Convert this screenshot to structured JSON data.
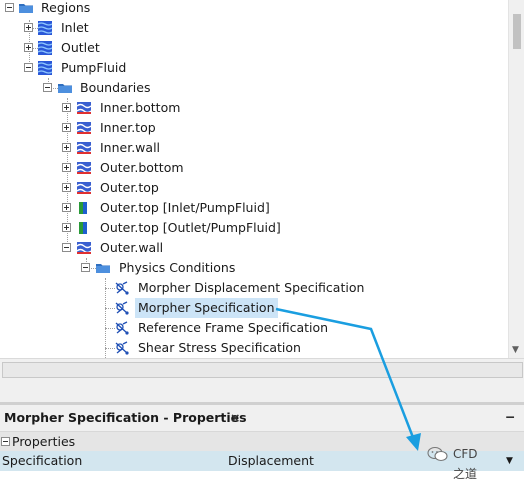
{
  "tree": {
    "regions": "Regions",
    "inlet": "Inlet",
    "outlet": "Outlet",
    "pumpfluid": "PumpFluid",
    "boundaries": "Boundaries",
    "items": [
      "Inner.bottom",
      "Inner.top",
      "Inner.wall",
      "Outer.bottom",
      "Outer.top",
      "Outer.top [Inlet/PumpFluid]",
      "Outer.top [Outlet/PumpFluid]",
      "Outer.wall"
    ],
    "physics_conditions": "Physics Conditions",
    "conditions": [
      "Morpher Displacement Specification",
      "Morpher Specification",
      "Reference Frame Specification",
      "Shear Stress Specification"
    ],
    "selected": "Morpher Specification"
  },
  "properties": {
    "title": "Morpher Specification - Properties",
    "close": "×",
    "minimize": "−",
    "group": "Properties",
    "prop_name": "Specification",
    "prop_value": "Displacement"
  },
  "watermark": {
    "text": "CFD之道"
  },
  "colors": {
    "accent_arrow": "#1a9ee0",
    "selection": "#cce4f7",
    "prop_row": "#d3e6ef"
  }
}
